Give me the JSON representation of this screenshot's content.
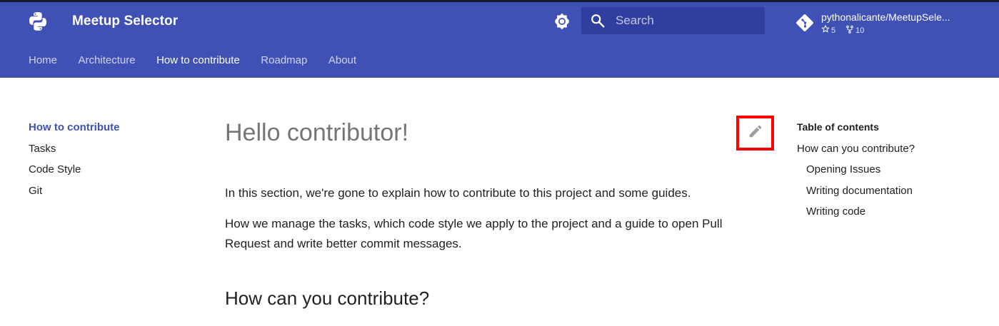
{
  "header": {
    "site_title": "Meetup Selector",
    "logo_icon": "python-logo-icon",
    "theme_icon": "brightness-icon",
    "search": {
      "placeholder": "Search",
      "icon": "search-icon"
    },
    "repo": {
      "name": "pythonalicante/MeetupSele...",
      "stars": "5",
      "forks": "10",
      "icon": "git-icon"
    },
    "colors": {
      "primary": "#3f51b5",
      "primary_dark": "#303f9f"
    }
  },
  "tabs": [
    {
      "label": "Home",
      "active": false
    },
    {
      "label": "Architecture",
      "active": false
    },
    {
      "label": "How to contribute",
      "active": true
    },
    {
      "label": "Roadmap",
      "active": false
    },
    {
      "label": "About",
      "active": false
    }
  ],
  "sidebar": {
    "items": [
      {
        "label": "How to contribute",
        "active": true
      },
      {
        "label": "Tasks"
      },
      {
        "label": "Code Style"
      },
      {
        "label": "Git"
      }
    ]
  },
  "main": {
    "title": "Hello contributor!",
    "paragraphs": [
      "In this section, we're gone to explain how to contribute to this project and some guides.",
      "How we manage the tasks, which code style we apply to the project and a guide to open Pull Request and write better commit messages."
    ],
    "subtitle": "How can you contribute?",
    "edit_icon": "pencil-edit-icon",
    "highlight_color": "#ff0000"
  },
  "toc": {
    "title": "Table of contents",
    "items": [
      {
        "label": "How can you contribute?",
        "level": 1
      },
      {
        "label": "Opening Issues",
        "level": 2
      },
      {
        "label": "Writing documentation",
        "level": 2
      },
      {
        "label": "Writing code",
        "level": 2
      }
    ]
  }
}
